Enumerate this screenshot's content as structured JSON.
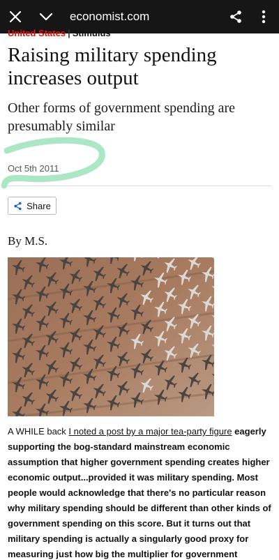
{
  "browser": {
    "url": "economist.com",
    "close_icon": "close-icon",
    "chevron_icon": "chevron-down-icon",
    "share_icon": "share-icon",
    "menu_icon": "more-vert-icon"
  },
  "article": {
    "section": "United States",
    "blog": "Stimulus",
    "headline": "Raising military spending increases output",
    "subheadline": "Other forms of government spending are presumably similar",
    "date": "Oct 5th 2011",
    "share_label": "Share",
    "byline": "By M.S.",
    "image_alt": "Rows of military aircraft parked in a desert boneyard",
    "body_lead": "A WHILE back ",
    "body_link": "I noted a post by a major tea-party figure",
    "body_rest": " eagerly supporting the bog-standard mainstream economic assumption that higher government spending creates higher economic output...provided it was military spending. Most people would acknowledge that there's no particular reason why military spending should be different than other kinds of government spending on this score. But it turns out that military spending is actually a singularly good proxy for measuring just how big the multiplier for government spending is. A new paper by Jón"
  },
  "colors": {
    "topbar": "#161616",
    "section_red": "#e3120b",
    "highlight": "#a8e6c2"
  }
}
